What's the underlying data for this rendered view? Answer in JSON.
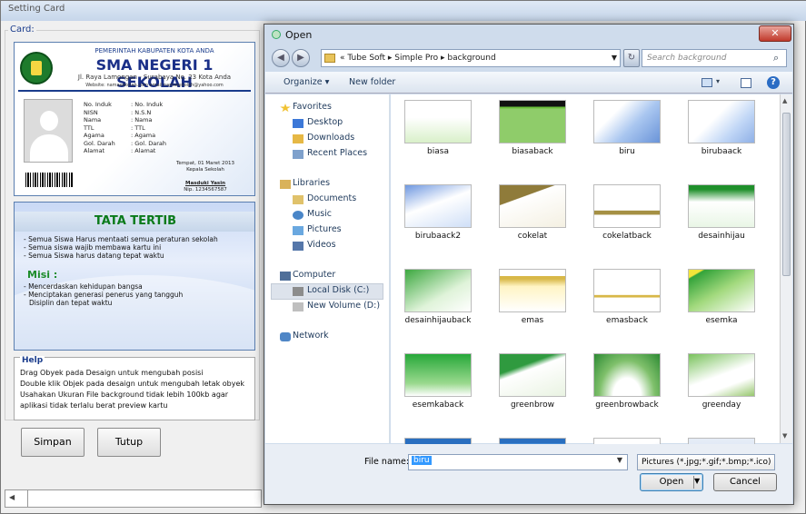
{
  "setting_window": {
    "title": "Setting Card",
    "card_label": "Card:",
    "card_front": {
      "header_line1": "PEMERINTAH KABUPATEN KOTA ANDA",
      "school_name": "SMA NEGERI 1 SEKOLAH",
      "address": "Jl. Raya Lamongan - Surabaya No. 23 Kota Anda",
      "website": "Website: namasekolah.com email:namasekolah@yahoo.com",
      "fields": [
        {
          "label": "No. Induk",
          "value": ": No. Induk"
        },
        {
          "label": "NISN",
          "value": ": N.S.N"
        },
        {
          "label": "Nama",
          "value": ": Nama"
        },
        {
          "label": "TTL",
          "value": ": TTL"
        },
        {
          "label": "Agama",
          "value": ": Agama"
        },
        {
          "label": "Gol. Darah",
          "value": ": Gol. Darah"
        },
        {
          "label": "Alamat",
          "value": ": Alamat"
        }
      ],
      "sign_place": "Tempat, 01 Maret 2013",
      "sign_title": "Kepala Sekolah",
      "sign_name": "Masduki Yasin",
      "sign_nip": "Nip. 1234567587"
    },
    "card_back": {
      "title": "TATA TERTIB",
      "rules": [
        "- Semua Siswa Harus mentaati semua peraturan sekolah",
        "- Semua siswa wajib membawa kartu ini",
        "- Semua Siswa harus datang tepat waktu"
      ],
      "misi_title": "Misi :",
      "misi": [
        "- Mencerdaskan kehidupan bangsa",
        "- Menciptakan generasi penerus yang tangguh",
        "  Disiplin dan tepat waktu"
      ]
    },
    "help": {
      "title": "Help",
      "lines": [
        "Drag Obyek pada Desaign untuk mengubah posisi",
        "Double klik Objek pada desaign untuk mengubah letak obyek",
        "Usahakan Ukuran File background tidak lebih 100kb agar",
        "aplikasi tidak terlalu berat preview kartu"
      ]
    },
    "buttons": {
      "save": "Simpan",
      "close": "Tutup"
    }
  },
  "open_dialog": {
    "title": "Open",
    "close_glyph": "✕",
    "address_path": "« Tube Soft  ▸  Simple Pro  ▸  background",
    "search_placeholder": "Search background",
    "toolbar": {
      "organize": "Organize ▾",
      "new_folder": "New folder"
    },
    "nav": {
      "favorites_header": "Favorites",
      "favorites": [
        "Desktop",
        "Downloads",
        "Recent Places"
      ],
      "libraries_header": "Libraries",
      "libraries": [
        "Documents",
        "Music",
        "Pictures",
        "Videos"
      ],
      "computer_header": "Computer",
      "computer": [
        "Local Disk (C:)",
        "New Volume (D:)"
      ],
      "network": "Network"
    },
    "files": [
      {
        "name": "biasa",
        "style": "biasa"
      },
      {
        "name": "biasaback",
        "style": "biasaback"
      },
      {
        "name": "biru",
        "style": "biru"
      },
      {
        "name": "birubaack",
        "style": "birubaack"
      },
      {
        "name": "birubaack2",
        "style": "birubaack2"
      },
      {
        "name": "cokelat",
        "style": "cokelat"
      },
      {
        "name": "cokelatback",
        "style": "cokelatback"
      },
      {
        "name": "desainhijau",
        "style": "desainhijau"
      },
      {
        "name": "desainhijauback",
        "style": "desainhijauback"
      },
      {
        "name": "emas",
        "style": "emas"
      },
      {
        "name": "emasback",
        "style": "emasback"
      },
      {
        "name": "esemka",
        "style": "esemka"
      },
      {
        "name": "esemkaback",
        "style": "esemkaback"
      },
      {
        "name": "greenbrow",
        "style": "greenbrow"
      },
      {
        "name": "greenbrowback",
        "style": "greenbrowback"
      },
      {
        "name": "greenday",
        "style": "greenday"
      },
      {
        "name": "",
        "style": "row5a"
      },
      {
        "name": "",
        "style": "row5b"
      },
      {
        "name": "",
        "style": "row5c"
      },
      {
        "name": "",
        "style": "row5d"
      }
    ],
    "file_name_label": "File name:",
    "file_name_value": "biru",
    "file_type": "Pictures (*.jpg;*.gif;*.bmp;*.ico)",
    "open_button": "Open",
    "cancel_button": "Cancel"
  }
}
